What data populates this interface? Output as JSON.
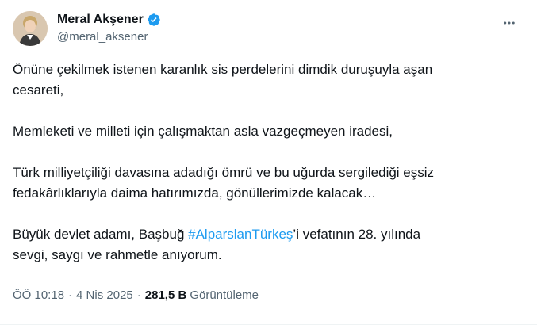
{
  "author": {
    "display_name": "Meral Akşener",
    "handle": "@meral_aksener",
    "verified": true
  },
  "tweet": {
    "paragraphs": [
      "Önüne çekilmek istenen karanlık sis perdelerini dimdik duruşuyla aşan\ncesareti,",
      "Memleketi ve milleti için çalışmaktan asla vazgeçmeyen iradesi,",
      "Türk milliyetçiliği davasına adadığı ömrü ve bu uğurda sergilediği eşsiz\nfedakârlıklarıyla daima hatırımızda, gönüllerimizde kalacak…"
    ],
    "last_paragraph": {
      "before": "Büyük devlet adamı, Başbuğ ",
      "hashtag": "#AlparslanTürkeş",
      "after": "’i vefatının 28. yılında\nsevgi, saygı ve rahmetle anıyorum."
    }
  },
  "meta": {
    "time": "ÖÖ 10:18",
    "separator": "·",
    "date": "4 Nis 2025",
    "views_count": "281,5 B",
    "views_label": "Görüntüleme"
  },
  "colors": {
    "accent": "#1d9bf0",
    "secondary_text": "#536471",
    "primary_text": "#0f1419"
  },
  "icons": {
    "verified": "verified-badge-icon",
    "more": "more-horizontal-icon"
  }
}
